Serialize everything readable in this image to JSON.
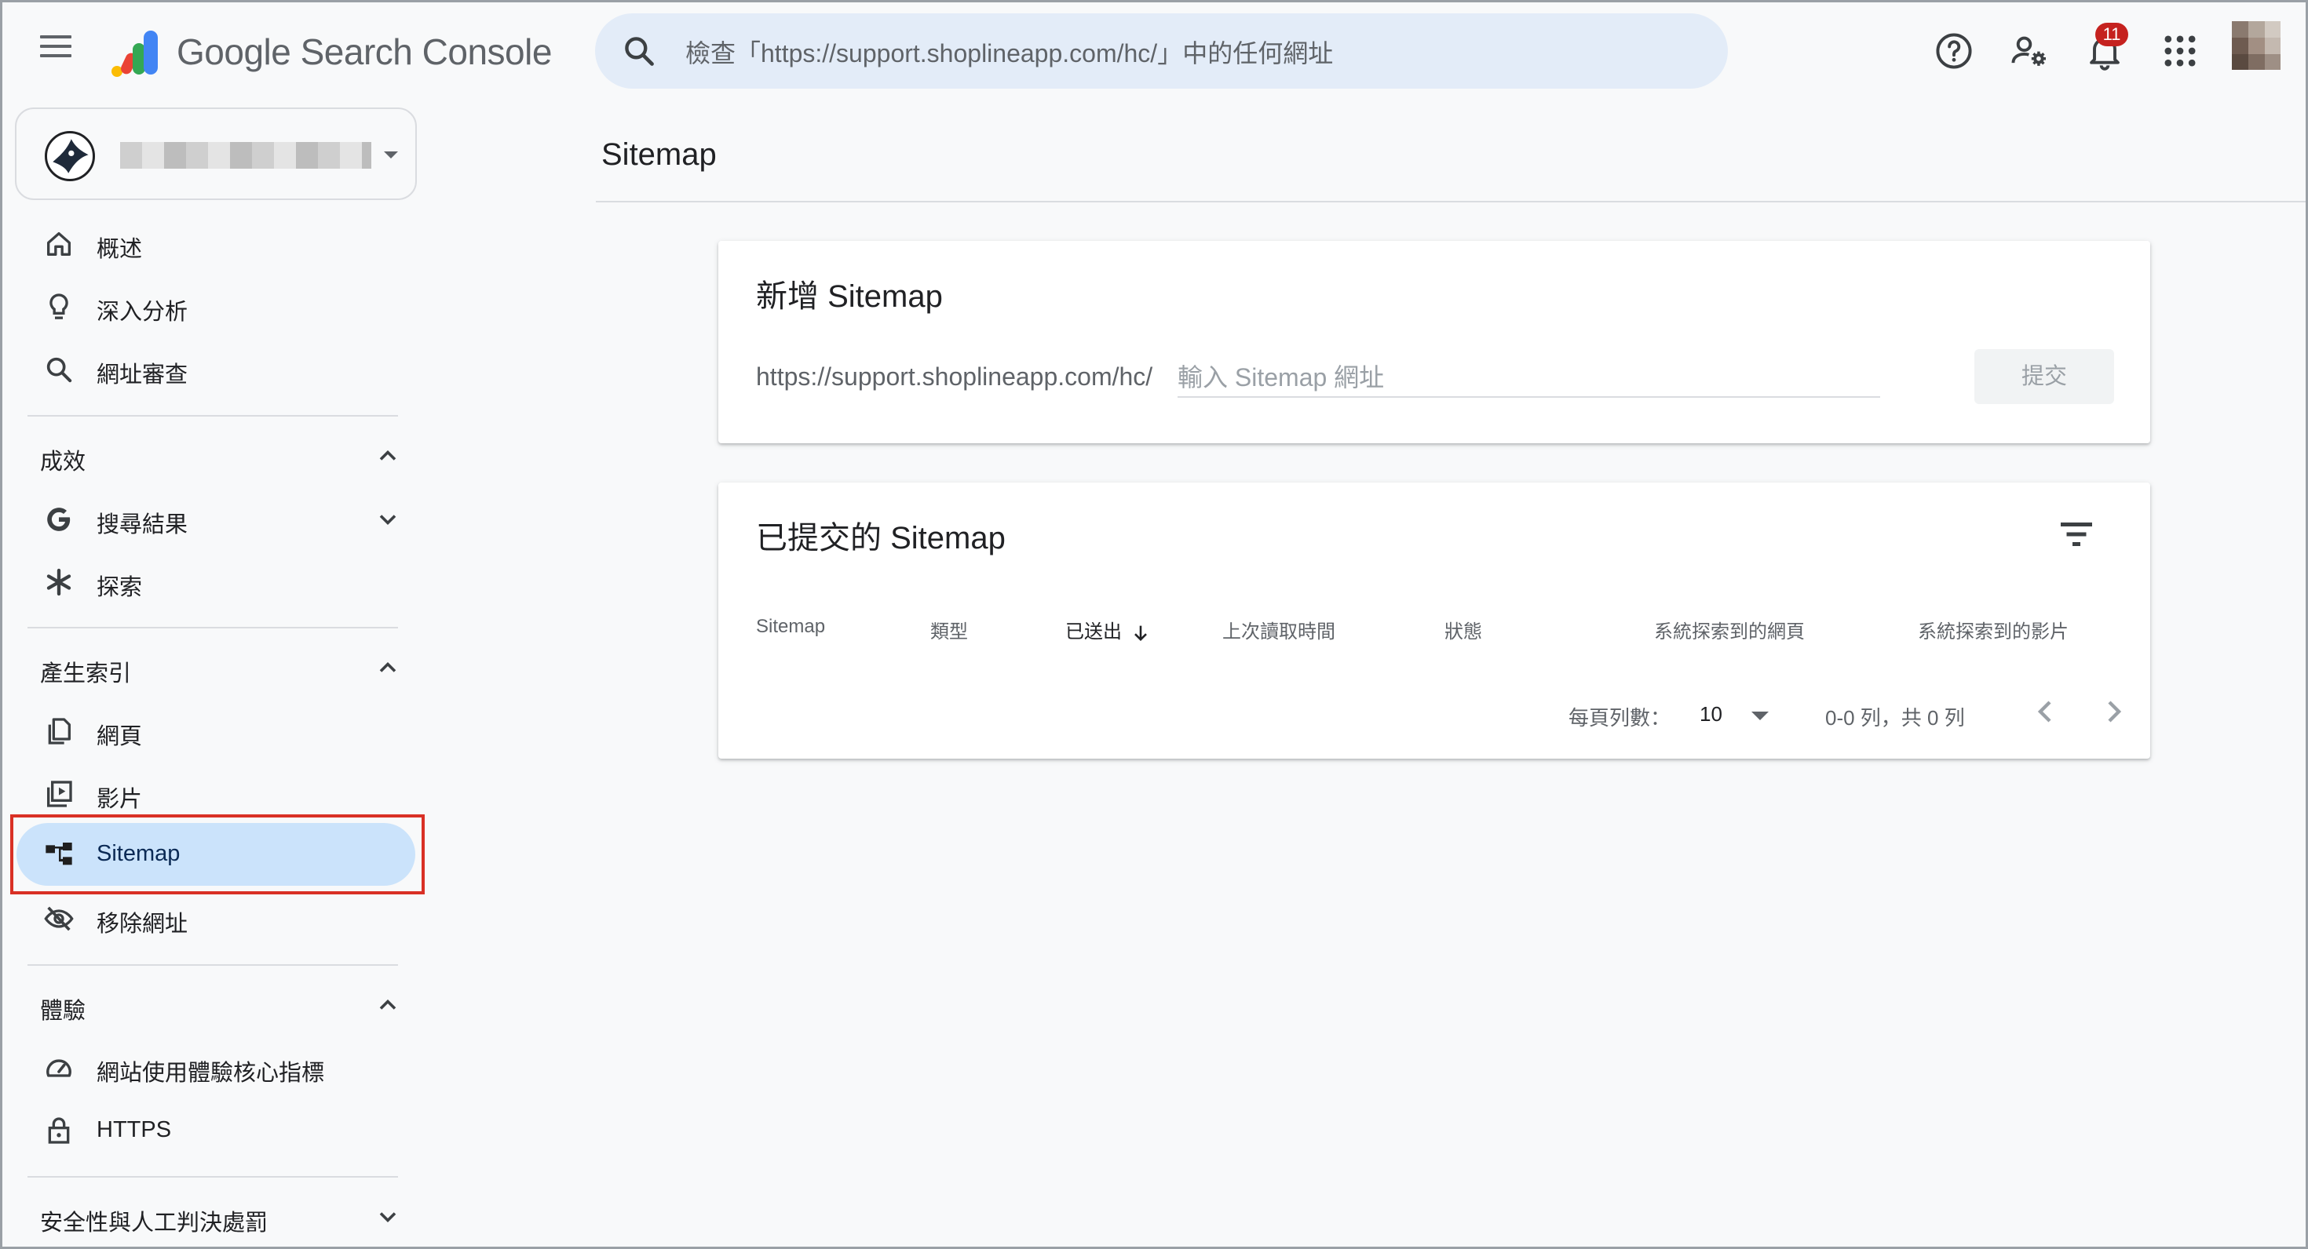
{
  "app": {
    "product_name": "Google Search Console",
    "search_placeholder": "檢查「https://support.shoplineapp.com/hc/」中的任何網址",
    "notification_count": "11"
  },
  "sidebar": {
    "top_items": [
      {
        "label": "概述",
        "icon": "home-icon"
      },
      {
        "label": "深入分析",
        "icon": "lightbulb-icon"
      },
      {
        "label": "網址審查",
        "icon": "search-icon"
      }
    ],
    "sections": {
      "performance": {
        "label": "成效",
        "items": [
          {
            "label": "搜尋結果",
            "icon": "google-g-icon"
          },
          {
            "label": "探索",
            "icon": "asterisk-icon"
          }
        ]
      },
      "indexing": {
        "label": "產生索引",
        "items": [
          {
            "label": "網頁",
            "icon": "pages-icon"
          },
          {
            "label": "影片",
            "icon": "video-icon"
          },
          {
            "label": "Sitemap",
            "icon": "sitemap-icon",
            "active": true
          },
          {
            "label": "移除網址",
            "icon": "eye-off-icon"
          }
        ]
      },
      "experience": {
        "label": "體驗",
        "items": [
          {
            "label": "網站使用體驗核心指標",
            "icon": "gauge-icon"
          },
          {
            "label": "HTTPS",
            "icon": "lock-icon"
          }
        ]
      },
      "security": {
        "label": "安全性與人工判決處罰"
      }
    }
  },
  "main": {
    "page_title": "Sitemap",
    "add_card": {
      "title": "新增 Sitemap",
      "url_prefix": "https://support.shoplineapp.com/hc/",
      "input_placeholder": "輸入 Sitemap 網址",
      "submit_label": "提交"
    },
    "submitted_card": {
      "title": "已提交的 Sitemap",
      "columns": [
        "Sitemap",
        "類型",
        "已送出",
        "上次讀取時間",
        "狀態",
        "系統探索到的網頁",
        "系統探索到的影片"
      ],
      "sorted_column": "已送出",
      "rows": [],
      "pagination": {
        "rows_per_page_label": "每頁列數：",
        "rows_per_page_value": "10",
        "range_text": "0-0 列，共 0 列"
      }
    }
  },
  "colors": {
    "accent_active_bg": "#cbe3fb",
    "search_bg": "#e3ecf8",
    "highlight_border": "#d93025",
    "badge": "#c5221f"
  }
}
